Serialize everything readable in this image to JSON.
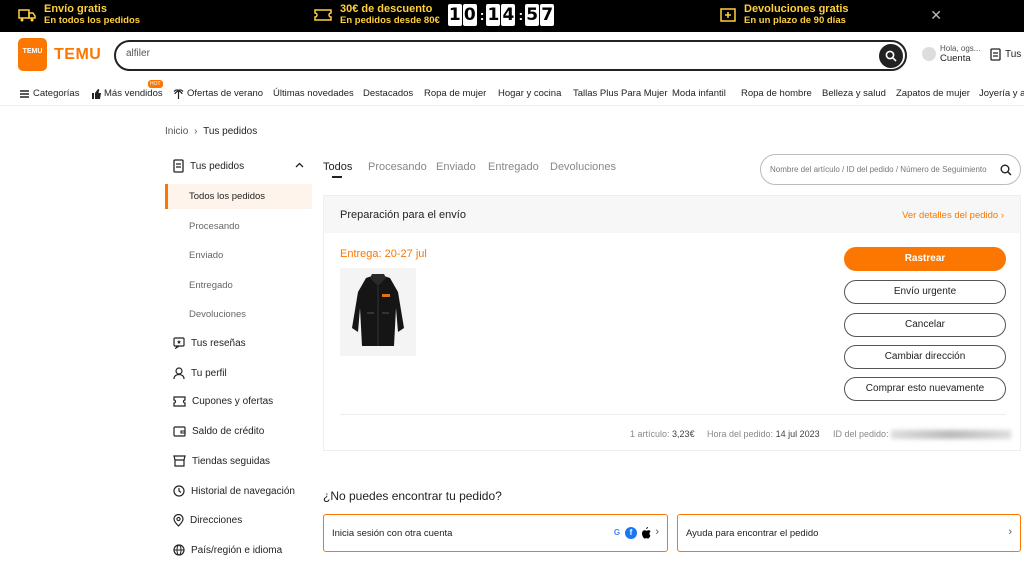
{
  "promo": {
    "shipping_title": "Envío gratis",
    "shipping_sub": "En todos los pedidos",
    "discount_title": "30€ de descuento",
    "discount_sub": "En pedidos desde 80€",
    "timer": [
      "1",
      "0",
      "1",
      "4",
      "5",
      "7"
    ],
    "returns_title": "Devoluciones gratis",
    "returns_sub": "En un plazo de 90 días",
    "close": "✕"
  },
  "header": {
    "logo_small": "TEMU",
    "logo_text": "TEMU",
    "search_value": "alfiler",
    "account_greeting": "Hola, ogs...",
    "account_label": "Cuenta",
    "orders_label": "Tus p"
  },
  "nav": {
    "items": [
      "Categorías",
      "Más vendidos",
      "Ofertas de verano",
      "Últimas novedades",
      "Destacados",
      "Ropa de mujer",
      "Hogar y cocina",
      "Tallas Plus Para Mujer",
      "Moda infantil",
      "Ropa de hombre",
      "Belleza y salud",
      "Zapatos de mujer",
      "Joyería y ac"
    ],
    "hot_badge": "HOT"
  },
  "breadcrumb": {
    "home": "Inicio",
    "sep": "›",
    "current": "Tus pedidos"
  },
  "sidebar": {
    "orders": "Tus pedidos",
    "subitems": [
      "Todos los pedidos",
      "Procesando",
      "Enviado",
      "Entregado",
      "Devoluciones"
    ],
    "items": [
      "Tus reseñas",
      "Tu perfil",
      "Cupones y ofertas",
      "Saldo de crédito",
      "Tiendas seguidas",
      "Historial de navegación",
      "Direcciones",
      "País/región e idioma"
    ]
  },
  "tabs": [
    "Todos",
    "Procesando",
    "Enviado",
    "Entregado",
    "Devoluciones"
  ],
  "order_search": {
    "placeholder": "Nombre del artículo / ID del pedido / Número de Seguimiento"
  },
  "order": {
    "status": "Preparación para el envío",
    "details_link": "Ver detalles del pedido ›",
    "delivery": "Entrega: 20-27 jul",
    "buttons": [
      "Rastrear",
      "Envío urgente",
      "Cancelar",
      "Cambiar dirección",
      "Comprar esto nuevamente"
    ],
    "items_label": "1 artículo:",
    "items_value": "3,23€",
    "time_label": "Hora del pedido:",
    "time_value": "14 jul 2023",
    "id_label": "ID del pedido:"
  },
  "help": {
    "title": "¿No puedes encontrar tu pedido?",
    "signin": "Inicia sesión con otra cuenta",
    "help_find": "Ayuda para encontrar el pedido",
    "chevron": "›"
  },
  "colors": {
    "accent": "#fb7701",
    "promo_bg": "#000000",
    "promo_text": "#ffd03b"
  }
}
